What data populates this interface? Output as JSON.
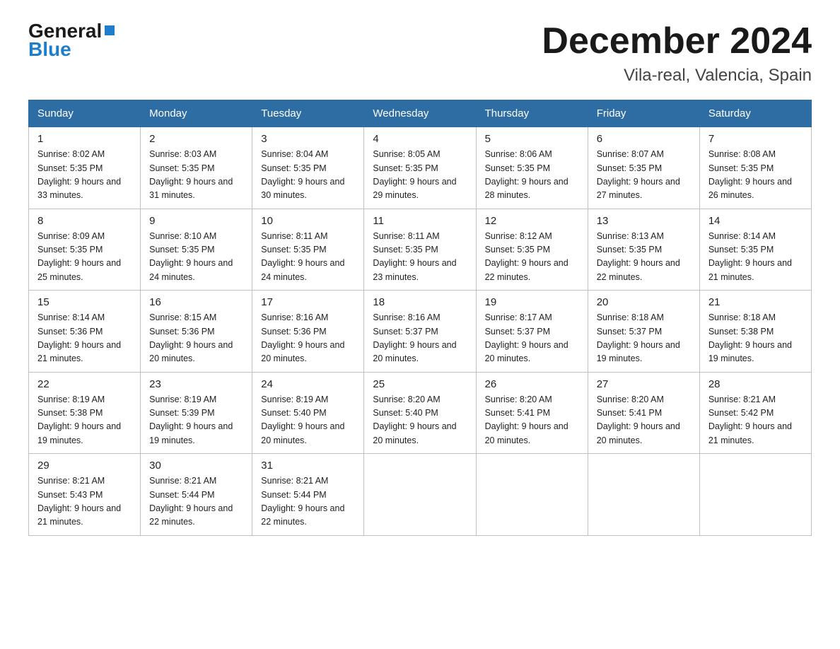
{
  "header": {
    "logo_general": "General",
    "logo_blue": "Blue",
    "title": "December 2024",
    "subtitle": "Vila-real, Valencia, Spain"
  },
  "columns": [
    "Sunday",
    "Monday",
    "Tuesday",
    "Wednesday",
    "Thursday",
    "Friday",
    "Saturday"
  ],
  "weeks": [
    [
      {
        "day": "1",
        "sunrise": "Sunrise: 8:02 AM",
        "sunset": "Sunset: 5:35 PM",
        "daylight": "Daylight: 9 hours and 33 minutes."
      },
      {
        "day": "2",
        "sunrise": "Sunrise: 8:03 AM",
        "sunset": "Sunset: 5:35 PM",
        "daylight": "Daylight: 9 hours and 31 minutes."
      },
      {
        "day": "3",
        "sunrise": "Sunrise: 8:04 AM",
        "sunset": "Sunset: 5:35 PM",
        "daylight": "Daylight: 9 hours and 30 minutes."
      },
      {
        "day": "4",
        "sunrise": "Sunrise: 8:05 AM",
        "sunset": "Sunset: 5:35 PM",
        "daylight": "Daylight: 9 hours and 29 minutes."
      },
      {
        "day": "5",
        "sunrise": "Sunrise: 8:06 AM",
        "sunset": "Sunset: 5:35 PM",
        "daylight": "Daylight: 9 hours and 28 minutes."
      },
      {
        "day": "6",
        "sunrise": "Sunrise: 8:07 AM",
        "sunset": "Sunset: 5:35 PM",
        "daylight": "Daylight: 9 hours and 27 minutes."
      },
      {
        "day": "7",
        "sunrise": "Sunrise: 8:08 AM",
        "sunset": "Sunset: 5:35 PM",
        "daylight": "Daylight: 9 hours and 26 minutes."
      }
    ],
    [
      {
        "day": "8",
        "sunrise": "Sunrise: 8:09 AM",
        "sunset": "Sunset: 5:35 PM",
        "daylight": "Daylight: 9 hours and 25 minutes."
      },
      {
        "day": "9",
        "sunrise": "Sunrise: 8:10 AM",
        "sunset": "Sunset: 5:35 PM",
        "daylight": "Daylight: 9 hours and 24 minutes."
      },
      {
        "day": "10",
        "sunrise": "Sunrise: 8:11 AM",
        "sunset": "Sunset: 5:35 PM",
        "daylight": "Daylight: 9 hours and 24 minutes."
      },
      {
        "day": "11",
        "sunrise": "Sunrise: 8:11 AM",
        "sunset": "Sunset: 5:35 PM",
        "daylight": "Daylight: 9 hours and 23 minutes."
      },
      {
        "day": "12",
        "sunrise": "Sunrise: 8:12 AM",
        "sunset": "Sunset: 5:35 PM",
        "daylight": "Daylight: 9 hours and 22 minutes."
      },
      {
        "day": "13",
        "sunrise": "Sunrise: 8:13 AM",
        "sunset": "Sunset: 5:35 PM",
        "daylight": "Daylight: 9 hours and 22 minutes."
      },
      {
        "day": "14",
        "sunrise": "Sunrise: 8:14 AM",
        "sunset": "Sunset: 5:35 PM",
        "daylight": "Daylight: 9 hours and 21 minutes."
      }
    ],
    [
      {
        "day": "15",
        "sunrise": "Sunrise: 8:14 AM",
        "sunset": "Sunset: 5:36 PM",
        "daylight": "Daylight: 9 hours and 21 minutes."
      },
      {
        "day": "16",
        "sunrise": "Sunrise: 8:15 AM",
        "sunset": "Sunset: 5:36 PM",
        "daylight": "Daylight: 9 hours and 20 minutes."
      },
      {
        "day": "17",
        "sunrise": "Sunrise: 8:16 AM",
        "sunset": "Sunset: 5:36 PM",
        "daylight": "Daylight: 9 hours and 20 minutes."
      },
      {
        "day": "18",
        "sunrise": "Sunrise: 8:16 AM",
        "sunset": "Sunset: 5:37 PM",
        "daylight": "Daylight: 9 hours and 20 minutes."
      },
      {
        "day": "19",
        "sunrise": "Sunrise: 8:17 AM",
        "sunset": "Sunset: 5:37 PM",
        "daylight": "Daylight: 9 hours and 20 minutes."
      },
      {
        "day": "20",
        "sunrise": "Sunrise: 8:18 AM",
        "sunset": "Sunset: 5:37 PM",
        "daylight": "Daylight: 9 hours and 19 minutes."
      },
      {
        "day": "21",
        "sunrise": "Sunrise: 8:18 AM",
        "sunset": "Sunset: 5:38 PM",
        "daylight": "Daylight: 9 hours and 19 minutes."
      }
    ],
    [
      {
        "day": "22",
        "sunrise": "Sunrise: 8:19 AM",
        "sunset": "Sunset: 5:38 PM",
        "daylight": "Daylight: 9 hours and 19 minutes."
      },
      {
        "day": "23",
        "sunrise": "Sunrise: 8:19 AM",
        "sunset": "Sunset: 5:39 PM",
        "daylight": "Daylight: 9 hours and 19 minutes."
      },
      {
        "day": "24",
        "sunrise": "Sunrise: 8:19 AM",
        "sunset": "Sunset: 5:40 PM",
        "daylight": "Daylight: 9 hours and 20 minutes."
      },
      {
        "day": "25",
        "sunrise": "Sunrise: 8:20 AM",
        "sunset": "Sunset: 5:40 PM",
        "daylight": "Daylight: 9 hours and 20 minutes."
      },
      {
        "day": "26",
        "sunrise": "Sunrise: 8:20 AM",
        "sunset": "Sunset: 5:41 PM",
        "daylight": "Daylight: 9 hours and 20 minutes."
      },
      {
        "day": "27",
        "sunrise": "Sunrise: 8:20 AM",
        "sunset": "Sunset: 5:41 PM",
        "daylight": "Daylight: 9 hours and 20 minutes."
      },
      {
        "day": "28",
        "sunrise": "Sunrise: 8:21 AM",
        "sunset": "Sunset: 5:42 PM",
        "daylight": "Daylight: 9 hours and 21 minutes."
      }
    ],
    [
      {
        "day": "29",
        "sunrise": "Sunrise: 8:21 AM",
        "sunset": "Sunset: 5:43 PM",
        "daylight": "Daylight: 9 hours and 21 minutes."
      },
      {
        "day": "30",
        "sunrise": "Sunrise: 8:21 AM",
        "sunset": "Sunset: 5:44 PM",
        "daylight": "Daylight: 9 hours and 22 minutes."
      },
      {
        "day": "31",
        "sunrise": "Sunrise: 8:21 AM",
        "sunset": "Sunset: 5:44 PM",
        "daylight": "Daylight: 9 hours and 22 minutes."
      },
      null,
      null,
      null,
      null
    ]
  ]
}
